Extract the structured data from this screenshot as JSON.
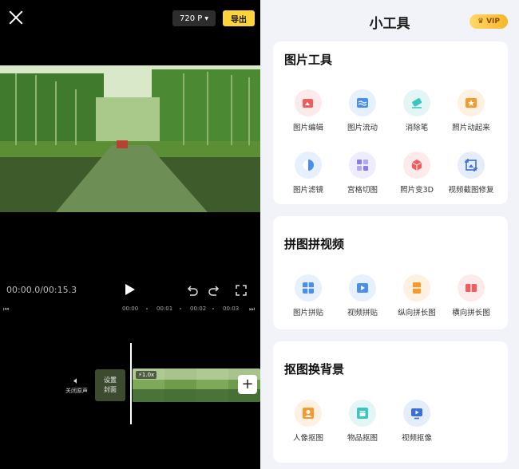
{
  "editor": {
    "resolution": "720 P",
    "export_label": "导出",
    "time_readout": "00:00.0/00:15.3",
    "ruler_ticks": [
      "00:00",
      "00:01",
      "00:02",
      "00:03"
    ],
    "mute_label": "关闭原声",
    "cover_label_line1": "设置",
    "cover_label_line2": "封面",
    "speed_badge": "1.0x"
  },
  "tools_panel": {
    "title": "小工具",
    "vip_label": "VIP",
    "sections": [
      {
        "title": "图片工具",
        "items": [
          {
            "label": "图片编辑",
            "icon": "image-edit-icon",
            "color": "#f25c5c"
          },
          {
            "label": "图片流动",
            "icon": "image-flow-icon",
            "color": "#4a8ef0"
          },
          {
            "label": "消除笔",
            "icon": "eraser-icon",
            "color": "#3cc4c0"
          },
          {
            "label": "照片动起来",
            "icon": "photo-animate-icon",
            "color": "#f59a2e"
          },
          {
            "label": "图片滤镜",
            "icon": "filter-icon",
            "color": "#4a8ef0"
          },
          {
            "label": "宫格切图",
            "icon": "grid-cut-icon",
            "color": "#8a7cf0"
          },
          {
            "label": "照片变3D",
            "icon": "cube-3d-icon",
            "color": "#f25c5c"
          },
          {
            "label": "视频截图修复",
            "icon": "video-crop-icon",
            "color": "#3a6fd8"
          }
        ]
      },
      {
        "title": "拼图拼视频",
        "items": [
          {
            "label": "图片拼贴",
            "icon": "image-collage-icon",
            "color": "#4a8ef0"
          },
          {
            "label": "视频拼贴",
            "icon": "video-collage-icon",
            "color": "#4a8ef0"
          },
          {
            "label": "纵向拼长图",
            "icon": "vertical-stitch-icon",
            "color": "#f59a2e"
          },
          {
            "label": "横向拼长图",
            "icon": "horizontal-stitch-icon",
            "color": "#f25c5c"
          }
        ]
      },
      {
        "title": "抠图换背景",
        "items": [
          {
            "label": "人像抠图",
            "icon": "portrait-cutout-icon",
            "color": "#f59a2e"
          },
          {
            "label": "物品抠图",
            "icon": "object-cutout-icon",
            "color": "#3cc4c0"
          },
          {
            "label": "视频抠像",
            "icon": "video-cutout-icon",
            "color": "#3a6fd8"
          }
        ]
      }
    ]
  }
}
